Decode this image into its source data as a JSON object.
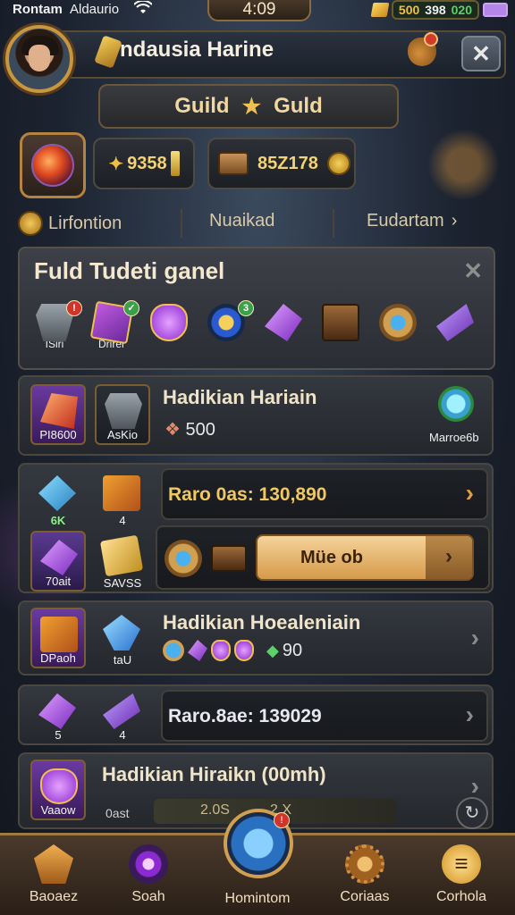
{
  "status_bar": {
    "carrier": "Rontam",
    "app": "Aldaurio",
    "time": "4:09",
    "gold": "500",
    "silver": "398",
    "green": "020"
  },
  "header": {
    "title": "ndausia Harine"
  },
  "guild": {
    "left": "Guild",
    "right": "Guld"
  },
  "currency": {
    "amount_a": "9358",
    "amount_b": "85Z178"
  },
  "tabs": [
    "Lirfontion",
    "Nuaikad",
    "Eudartam"
  ],
  "panel": {
    "title": "Fuld Tudeti ganel",
    "items": [
      {
        "icon": "helmet-icon",
        "caption": "ISiri",
        "badge": "!"
      },
      {
        "icon": "cube-icon",
        "caption": "Drirer",
        "badge": "✓"
      },
      {
        "icon": "gem-icon",
        "caption": "",
        "badge": ""
      },
      {
        "icon": "owl-icon",
        "caption": "",
        "badge": "3"
      },
      {
        "icon": "shard-icon",
        "caption": "",
        "badge": ""
      },
      {
        "icon": "box-icon",
        "caption": "",
        "badge": ""
      },
      {
        "icon": "gear-icon",
        "caption": "",
        "badge": ""
      },
      {
        "icon": "crystal-icon",
        "caption": "",
        "badge": ""
      }
    ]
  },
  "rows": {
    "row1": {
      "tile1_caption": "PI8600",
      "tile2_caption": "AsKio",
      "title": "Hadikian Hariain",
      "sub": "500",
      "right_caption": "Marroe6b"
    },
    "row2": {
      "tile1_caption": "6K",
      "tile2_caption": "4",
      "bar_text": "Raro 0as: 130,890"
    },
    "row3": {
      "tile1_caption": "70ait",
      "tile2_caption": "SAVSS",
      "button_label": "Müe ob"
    },
    "row4": {
      "tile1_caption": "DPaoh",
      "tile2_caption": "taU",
      "title": "Hadikian Hoealeniain",
      "sub": "90"
    },
    "row5": {
      "tile1_caption": "5",
      "tile2_caption": "4",
      "bar_text": "Raro.8ae: 139029"
    },
    "row6": {
      "tile1_caption": "Vaaow",
      "title": "Hadikian Hiraikn (00mh)",
      "sub_left": "0ast",
      "sub_mid": "2.0S",
      "sub_right": "2 X"
    }
  },
  "bottom_nav": [
    {
      "icon": "crest-icon",
      "label": "Baoaez"
    },
    {
      "icon": "orb-icon",
      "label": "Soah"
    },
    {
      "icon": "crystal-icon",
      "label": "Homintom"
    },
    {
      "icon": "gear-icon",
      "label": "Coriaas"
    },
    {
      "icon": "menu-icon",
      "label": "Corhola"
    }
  ],
  "colors": {
    "accent_gold": "#f0c860",
    "panel_border": "#55504a",
    "nav_bg": "#4a3a2c"
  }
}
